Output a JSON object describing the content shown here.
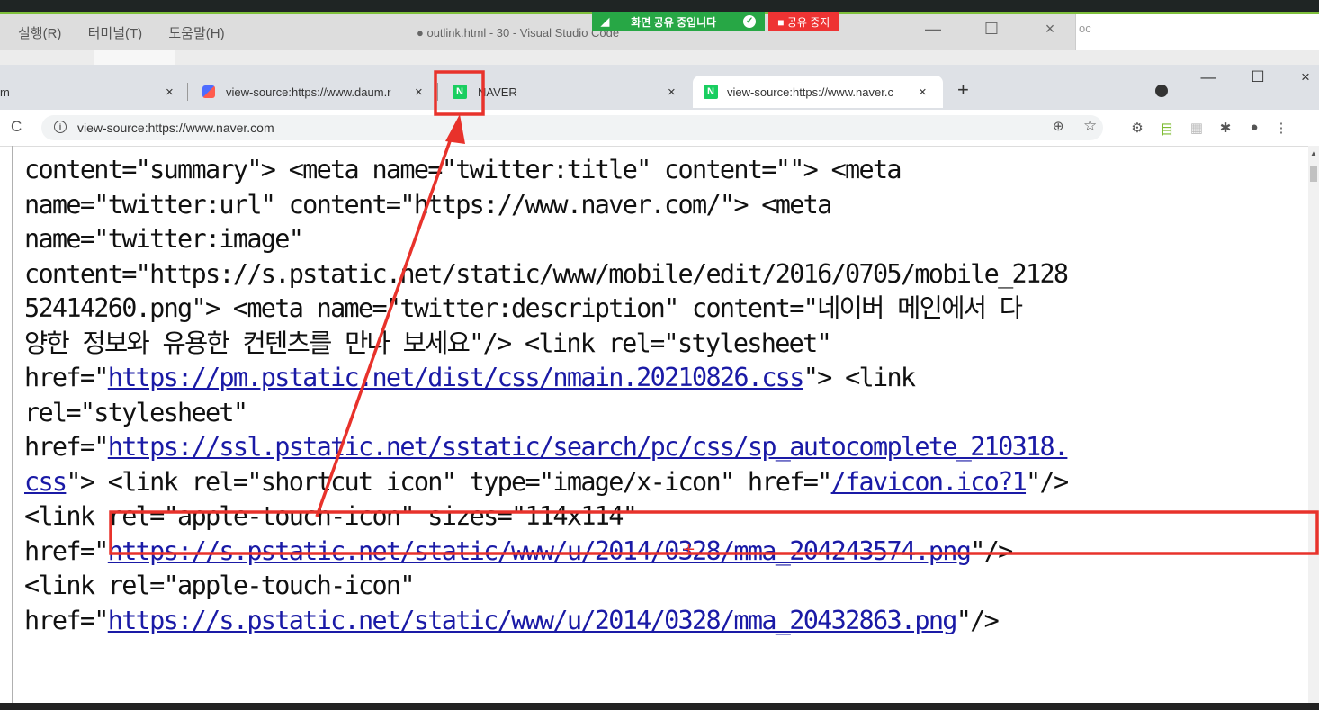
{
  "vscode": {
    "menu": [
      "실행(R)",
      "터미널(T)",
      "도움말(H)"
    ],
    "title": "● outlink.html - 30 - Visual Studio Code",
    "right_fragment": "oc"
  },
  "screen_share": {
    "status": "화면 공유 중입니다",
    "stop_label": "■ 공유 중지"
  },
  "browser": {
    "tabs": [
      {
        "title": "m",
        "favicon": "daum-favicon"
      },
      {
        "title": "view-source:https://www.daum.r",
        "favicon": "daum-favicon"
      },
      {
        "title": "NAVER",
        "favicon": "naver-favicon"
      },
      {
        "title": "view-source:https://www.naver.c",
        "favicon": "naver-favicon",
        "active": true
      }
    ],
    "new_tab": "+",
    "url": "view-source:https://www.naver.com",
    "close_glyph": "×"
  },
  "source_lines": [
    "content=\"summary\"> <meta name=\"twitter:title\" content=\"\"> <meta",
    "name=\"twitter:url\" content=\"https://www.naver.com/\"> <meta",
    "name=\"twitter:image\"",
    "content=\"https://s.pstatic.net/static/www/mobile/edit/2016/0705/mobile_2128",
    "52414260.png\"> <meta name=\"twitter:description\" content=\"네이버 메인에서 다",
    "양한 정보와 유용한 컨텐츠를 만나 보세요\"/> <link rel=\"stylesheet\"",
    "href=\"|https://pm.pstatic.net/dist/css/nmain.20210826.css|\"> <link",
    "rel=\"stylesheet\"",
    "href=\"|https://ssl.pstatic.net/sstatic/search/pc/css/sp_autocomplete_210318.",
    "|css|\"> <link rel=\"shortcut icon\" type=\"image/x-icon\" href=\"|/favicon.ico?1|\"/>",
    "<link rel=\"apple-touch-icon\" sizes=\"114x114\"",
    "href=\"|https://s.pstatic.net/static/www/u/2014/0328/mma_204243574.png|\"/>",
    "<link rel=\"apple-touch-icon\"",
    "href=\"|https://s.pstatic.net/static/www/u/2014/0328/mma_20432863.png|\"/>"
  ],
  "annotation_color": "#e8322b"
}
